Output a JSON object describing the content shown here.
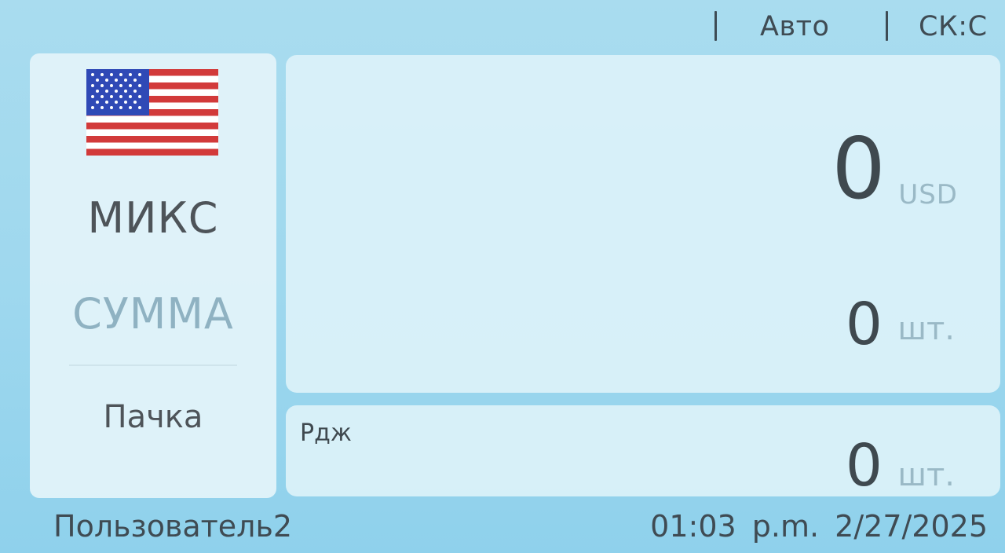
{
  "status_bar": {
    "mode": "Авто",
    "counting_mode": "СК:С"
  },
  "left_panel": {
    "flag_icon": "us-flag-icon",
    "mode_label": "МИКС",
    "sum_label": "СУММА",
    "batch_label": "Пачка"
  },
  "main_panel": {
    "amount": "0",
    "currency": "USD",
    "count": "0",
    "count_unit": "шт."
  },
  "reject_panel": {
    "label": "Рдж",
    "count": "0",
    "count_unit": "шт."
  },
  "footer": {
    "user": "Пользователь2",
    "time": "01:03 p.m.",
    "date": "2/27/2025"
  },
  "colors": {
    "background": "#9fd8ee",
    "panel": "#daf1f9",
    "text_dark": "#3f494f",
    "text_muted": "#9ab9c6"
  }
}
